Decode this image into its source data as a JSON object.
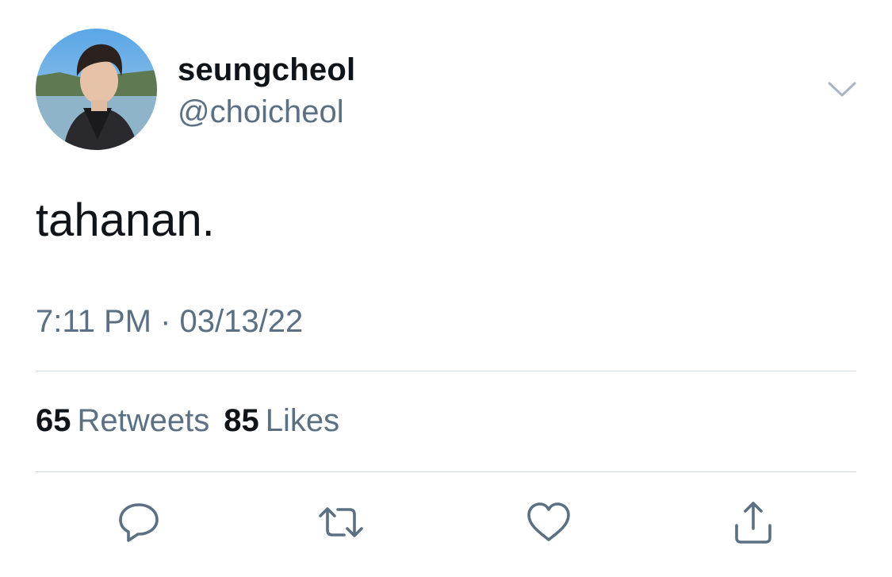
{
  "author": {
    "display_name": "seungcheol",
    "handle": "@choicheol"
  },
  "tweet": {
    "text": "tahanan.",
    "timestamp": "7:11 PM · 03/13/22"
  },
  "stats": {
    "retweets_count": "65",
    "retweets_label": "Retweets",
    "likes_count": "85",
    "likes_label": "Likes"
  },
  "icons": {
    "menu": "chevron-down-icon",
    "reply": "reply-icon",
    "retweet": "retweet-icon",
    "like": "heart-icon",
    "share": "share-icon"
  },
  "colors": {
    "text_primary": "#0f1419",
    "text_secondary": "#5b7083",
    "divider": "#cfd9de"
  }
}
